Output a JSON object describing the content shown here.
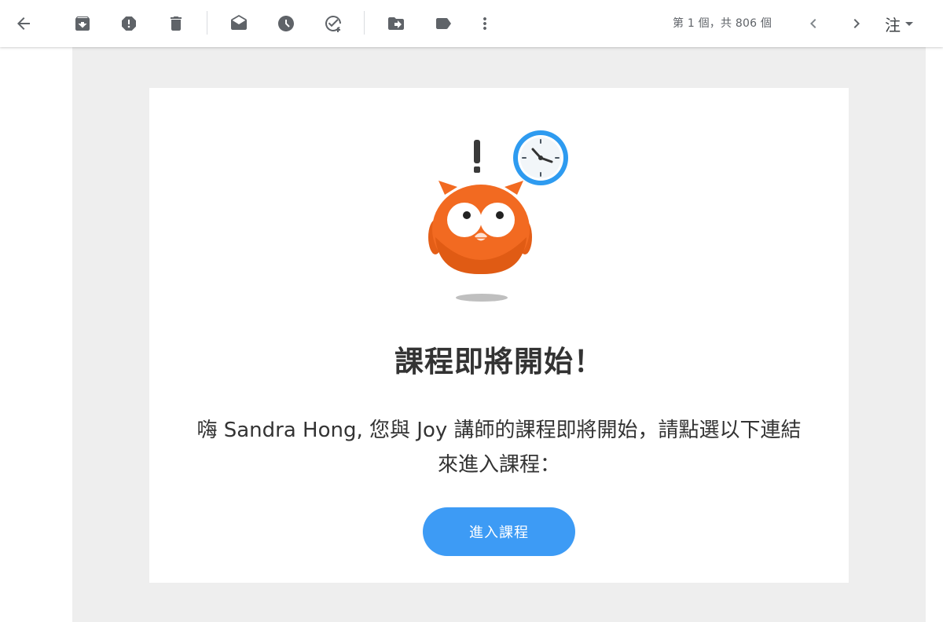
{
  "toolbar": {
    "pager_text": "第 1 個，共 806 個",
    "language_label": "注",
    "icons": [
      "back-arrow-icon",
      "archive-icon",
      "report-spam-icon",
      "delete-icon",
      "mark-as-read-icon",
      "snooze-icon",
      "add-to-tasks-icon",
      "move-to-icon",
      "label-icon",
      "more-vert-icon",
      "prev-icon",
      "next-icon"
    ]
  },
  "email": {
    "title": "課程即將開始！",
    "body": "嗨 Sandra Hong, 您與 Joy 講師的課程即將開始，請點選以下連結來進入課程：",
    "cta_label": "進入課程"
  },
  "colors": {
    "accent": "#3d9bf5",
    "owl": "#f26a21",
    "clock_ring": "#2e9bf0",
    "canvas": "#eeeeee"
  }
}
